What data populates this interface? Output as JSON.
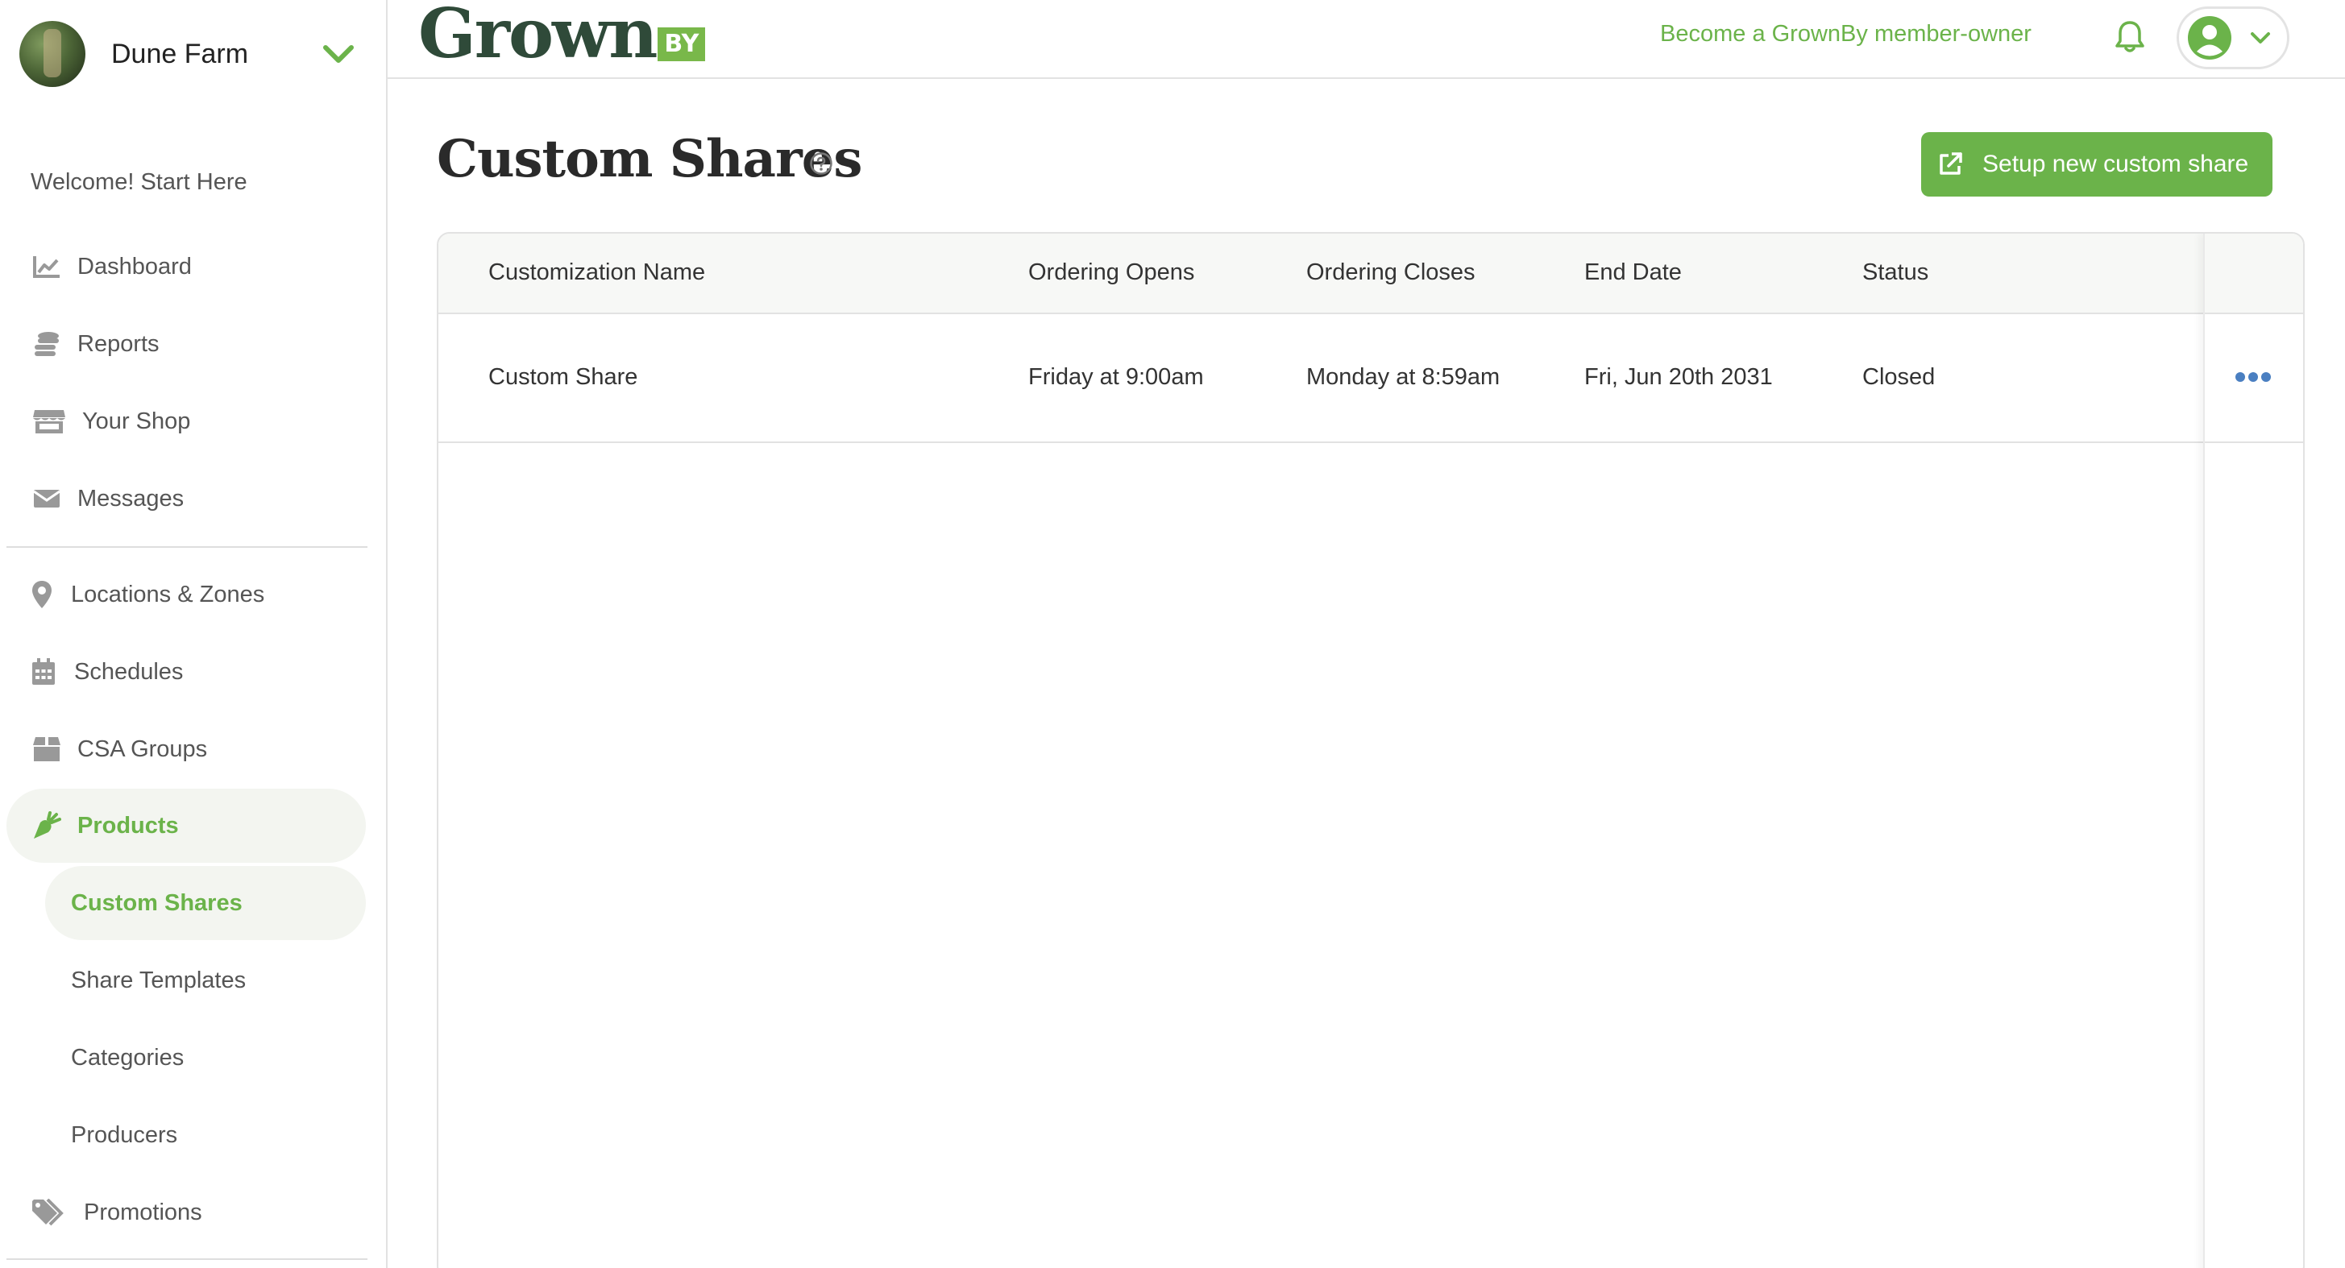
{
  "farm": {
    "name": "Dune Farm"
  },
  "nav": {
    "welcome": "Welcome! Start Here",
    "items": [
      {
        "label": "Dashboard",
        "icon": "chart-line-icon"
      },
      {
        "label": "Reports",
        "icon": "coins-icon"
      },
      {
        "label": "Your Shop",
        "icon": "store-icon"
      },
      {
        "label": "Messages",
        "icon": "envelope-icon"
      },
      {
        "label": "Locations & Zones",
        "icon": "map-pin-icon"
      },
      {
        "label": "Schedules",
        "icon": "calendar-icon"
      },
      {
        "label": "CSA Groups",
        "icon": "box-icon"
      },
      {
        "label": "Products",
        "icon": "carrot-icon",
        "active": true
      },
      {
        "label": "Promotions",
        "icon": "tags-icon"
      }
    ],
    "product_subitems": [
      {
        "label": "Custom Shares",
        "active": true
      },
      {
        "label": "Share Templates"
      },
      {
        "label": "Categories"
      },
      {
        "label": "Producers"
      }
    ]
  },
  "header": {
    "logo_text": "Grown",
    "logo_badge": "BY",
    "member_link": "Become a GrownBy member-owner"
  },
  "page": {
    "title": "Custom Shares",
    "setup_button": "Setup new custom share"
  },
  "table": {
    "columns": [
      "Customization Name",
      "Ordering Opens",
      "Ordering Closes",
      "End Date",
      "Status"
    ],
    "rows": [
      {
        "name": "Custom Share",
        "opens": "Friday at 9:00am",
        "closes": "Monday at 8:59am",
        "end_date": "Fri, Jun 20th 2031",
        "status": "Closed"
      }
    ]
  },
  "colors": {
    "brand_green": "#6bb34a",
    "logo_dark": "#2f4a39",
    "action_blue": "#4a7fc1"
  }
}
